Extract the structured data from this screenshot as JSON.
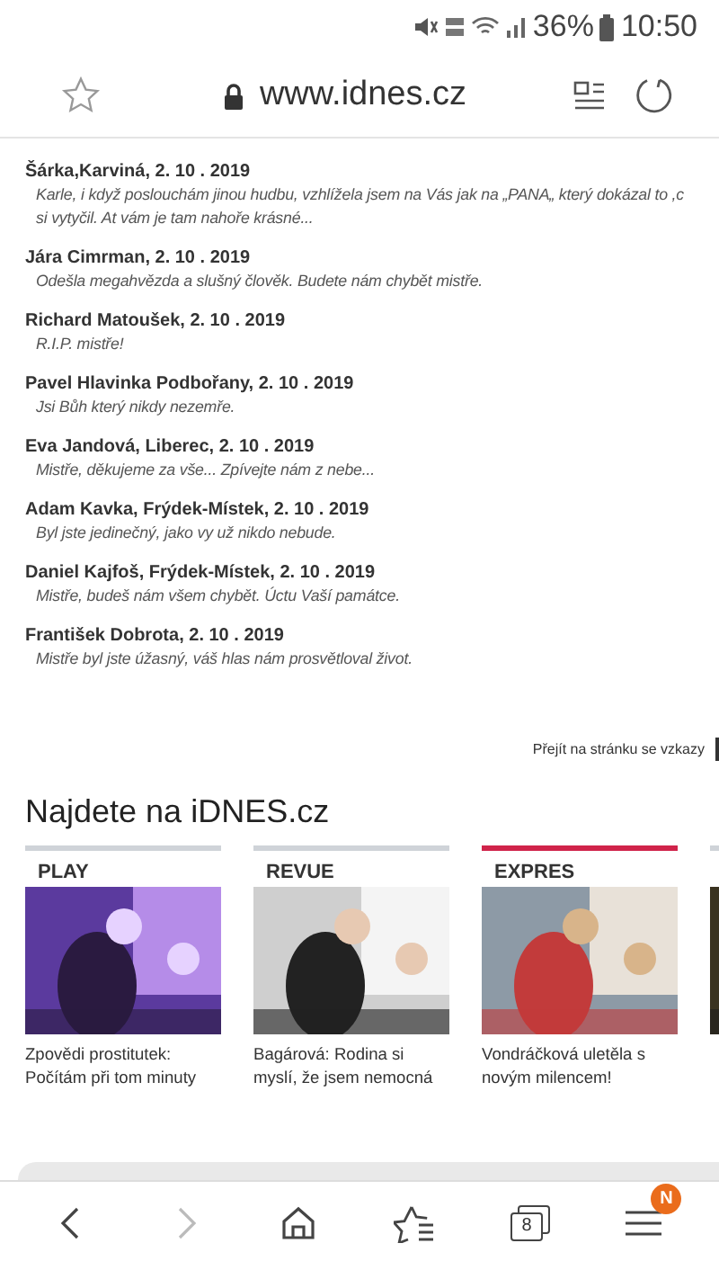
{
  "status_bar": {
    "battery": "36%",
    "time": "10:50"
  },
  "address_bar": {
    "url": "www.idnes.cz"
  },
  "comments": [
    {
      "author": "Šárka,Karviná, 2. 10 . 2019",
      "lines": [
        "Karle, i když poslouchám jinou hudbu, vzhlížela jsem na Vás jak na „PANA„ který dokázal to ,c",
        "si vytyčil. At vám je tam nahoře krásné..."
      ]
    },
    {
      "author": "Jára Cimrman, 2. 10 . 2019",
      "lines": [
        "Odešla megahvězda a slušný člověk. Budete nám chybět mistře."
      ]
    },
    {
      "author": "Richard Matoušek, 2. 10 . 2019",
      "lines": [
        "R.I.P. mistře!"
      ]
    },
    {
      "author": "Pavel Hlavinka Podbořany, 2. 10 . 2019",
      "lines": [
        "Jsi Bůh který nikdy nezemře."
      ]
    },
    {
      "author": "Eva Jandová, Liberec, 2. 10 . 2019",
      "lines": [
        "Mistře, děkujeme za vše... Zpívejte nám z nebe..."
      ]
    },
    {
      "author": "Adam Kavka, Frýdek-Místek, 2. 10 . 2019",
      "lines": [
        "Byl jste jedinečný, jako vy už nikdo nebude."
      ]
    },
    {
      "author": "Daniel Kajfoš, Frýdek-Místek, 2. 10 . 2019",
      "lines": [
        "Mistře, budeš nám všem chybět. Úctu Vaší památce."
      ]
    },
    {
      "author": "František Dobrota, 2. 10 . 2019",
      "lines": [
        "Mistře byl jste úžasný, váš hlas nám prosvětloval život."
      ]
    }
  ],
  "comments_link": "Přejít na stránku se vzkazy",
  "section_title": "Najdete na iDNES.cz",
  "cards": [
    {
      "label": "PLAY",
      "color": "#cfd3d8",
      "lines": [
        "Zpovědi prostitutek:",
        "Počítám při tom minuty"
      ]
    },
    {
      "label": "REVUE",
      "color": "#cfd3d8",
      "lines": [
        "Bagárová: Rodina si",
        "myslí, že jsem nemocná"
      ]
    },
    {
      "label": "EXPRES",
      "color": "#d0234a",
      "lines": [
        "Vondráčková uletěla s",
        "novým milencem!"
      ]
    },
    {
      "color": "#cfd3d8"
    }
  ],
  "bottom_nav": {
    "tab_count": "8",
    "menu_badge": "N",
    "forward_disabled": true
  }
}
